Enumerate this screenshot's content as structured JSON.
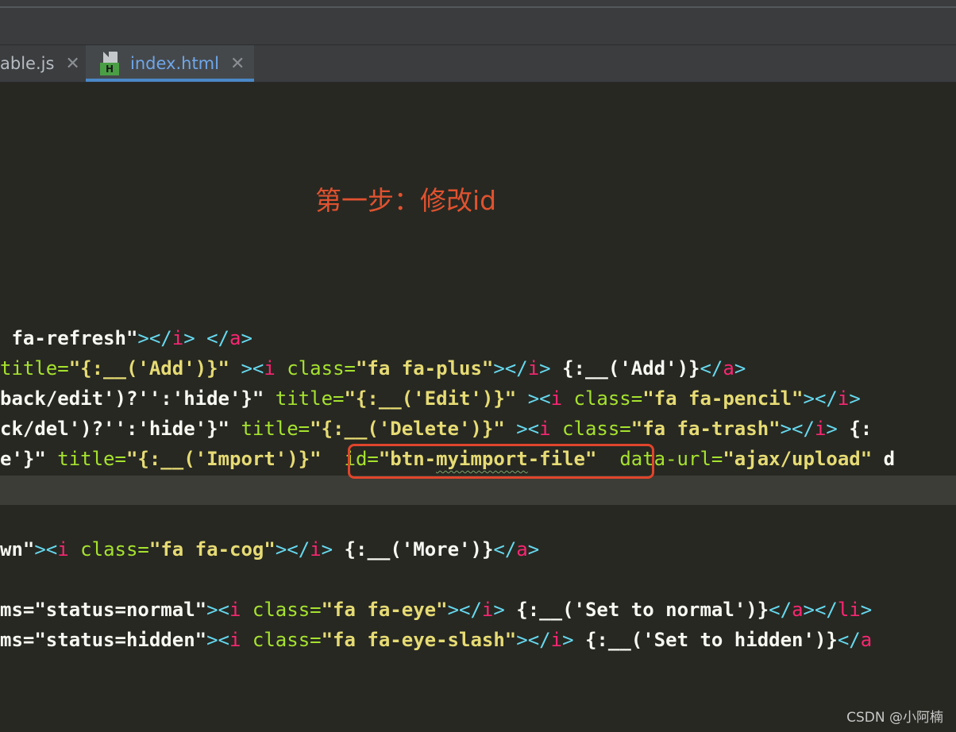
{
  "tabs": [
    {
      "name": "able.js",
      "close": "✕",
      "active": false
    },
    {
      "name": "index.html",
      "close": "✕",
      "active": true,
      "badge": "H"
    }
  ],
  "annotation": "第一步：修改id",
  "watermark": "CSDN @小阿楠",
  "code_lines": [
    [
      {
        "t": "txt",
        "v": " fa-refresh\""
      },
      {
        "t": "br",
        "v": "></"
      },
      {
        "t": "tag",
        "v": "i"
      },
      {
        "t": "br",
        "v": "> </"
      },
      {
        "t": "tag",
        "v": "a"
      },
      {
        "t": "br",
        "v": ">"
      }
    ],
    [
      {
        "t": "attr",
        "v": "title="
      },
      {
        "t": "str",
        "v": "\"{:__('Add')}\""
      },
      {
        "t": "txt",
        "v": " "
      },
      {
        "t": "br",
        "v": "><"
      },
      {
        "t": "tag",
        "v": "i "
      },
      {
        "t": "attr",
        "v": "class="
      },
      {
        "t": "str",
        "v": "\"fa fa-plus\""
      },
      {
        "t": "br",
        "v": "></"
      },
      {
        "t": "tag",
        "v": "i"
      },
      {
        "t": "br",
        "v": "> "
      },
      {
        "t": "txt",
        "v": "{:__('Add')}"
      },
      {
        "t": "br",
        "v": "</"
      },
      {
        "t": "tag",
        "v": "a"
      },
      {
        "t": "br",
        "v": ">"
      }
    ],
    [
      {
        "t": "txt",
        "v": "back/edit')?'':'hide'}\" "
      },
      {
        "t": "attr",
        "v": "title="
      },
      {
        "t": "str",
        "v": "\"{:__('Edit')}\""
      },
      {
        "t": "txt",
        "v": " "
      },
      {
        "t": "br",
        "v": "><"
      },
      {
        "t": "tag",
        "v": "i "
      },
      {
        "t": "attr",
        "v": "class="
      },
      {
        "t": "str",
        "v": "\"fa fa-pencil\""
      },
      {
        "t": "br",
        "v": "></"
      },
      {
        "t": "tag",
        "v": "i"
      },
      {
        "t": "br",
        "v": ">"
      }
    ],
    [
      {
        "t": "txt",
        "v": "ck/del')?'':'hide'}\" "
      },
      {
        "t": "attr",
        "v": "title="
      },
      {
        "t": "str",
        "v": "\"{:__('Delete')}\""
      },
      {
        "t": "txt",
        "v": " "
      },
      {
        "t": "br",
        "v": "><"
      },
      {
        "t": "tag",
        "v": "i "
      },
      {
        "t": "attr",
        "v": "class="
      },
      {
        "t": "str",
        "v": "\"fa fa-trash\""
      },
      {
        "t": "br",
        "v": "></"
      },
      {
        "t": "tag",
        "v": "i"
      },
      {
        "t": "br",
        "v": "> "
      },
      {
        "t": "txt",
        "v": "{:"
      }
    ],
    [
      {
        "t": "txt",
        "v": "e'}\" "
      },
      {
        "t": "attr",
        "v": "title="
      },
      {
        "t": "str",
        "v": "\"{:__('Import')}\""
      },
      {
        "t": "txt",
        "v": "  "
      },
      {
        "t": "attr",
        "v": "id="
      },
      {
        "t": "str",
        "v": "\"btn-"
      },
      {
        "t": "str sq",
        "v": "myimport"
      },
      {
        "t": "str",
        "v": "-file\""
      },
      {
        "t": "txt",
        "v": "  "
      },
      {
        "t": "attr",
        "v": "data-url="
      },
      {
        "t": "str",
        "v": "\"ajax/upload\""
      },
      {
        "t": "txt",
        "v": " d"
      }
    ],
    [],
    [
      {
        "t": "txt",
        "v": "wn\""
      },
      {
        "t": "br",
        "v": "><"
      },
      {
        "t": "tag",
        "v": "i "
      },
      {
        "t": "attr",
        "v": "class="
      },
      {
        "t": "str",
        "v": "\"fa fa-cog\""
      },
      {
        "t": "br",
        "v": "></"
      },
      {
        "t": "tag",
        "v": "i"
      },
      {
        "t": "br",
        "v": "> "
      },
      {
        "t": "txt",
        "v": "{:__('More')}"
      },
      {
        "t": "br",
        "v": "</"
      },
      {
        "t": "tag",
        "v": "a"
      },
      {
        "t": "br",
        "v": ">"
      }
    ],
    [],
    [
      {
        "t": "txt",
        "v": "ms=\"status=normal\""
      },
      {
        "t": "br",
        "v": "><"
      },
      {
        "t": "tag",
        "v": "i "
      },
      {
        "t": "attr",
        "v": "class="
      },
      {
        "t": "str",
        "v": "\"fa fa-eye\""
      },
      {
        "t": "br",
        "v": "></"
      },
      {
        "t": "tag",
        "v": "i"
      },
      {
        "t": "br",
        "v": "> "
      },
      {
        "t": "txt",
        "v": "{:__('Set to normal')}"
      },
      {
        "t": "br",
        "v": "</"
      },
      {
        "t": "tag",
        "v": "a"
      },
      {
        "t": "br",
        "v": "></"
      },
      {
        "t": "tag",
        "v": "li"
      },
      {
        "t": "br",
        "v": ">"
      }
    ],
    [
      {
        "t": "txt",
        "v": "ms=\"status=hidden\""
      },
      {
        "t": "br",
        "v": "><"
      },
      {
        "t": "tag",
        "v": "i "
      },
      {
        "t": "attr",
        "v": "class="
      },
      {
        "t": "str",
        "v": "\"fa fa-eye-slash\""
      },
      {
        "t": "br",
        "v": "></"
      },
      {
        "t": "tag",
        "v": "i"
      },
      {
        "t": "br",
        "v": "> "
      },
      {
        "t": "txt",
        "v": "{:__('Set to hidden')}"
      },
      {
        "t": "br",
        "v": "</"
      },
      {
        "t": "tag",
        "v": "a"
      }
    ]
  ]
}
